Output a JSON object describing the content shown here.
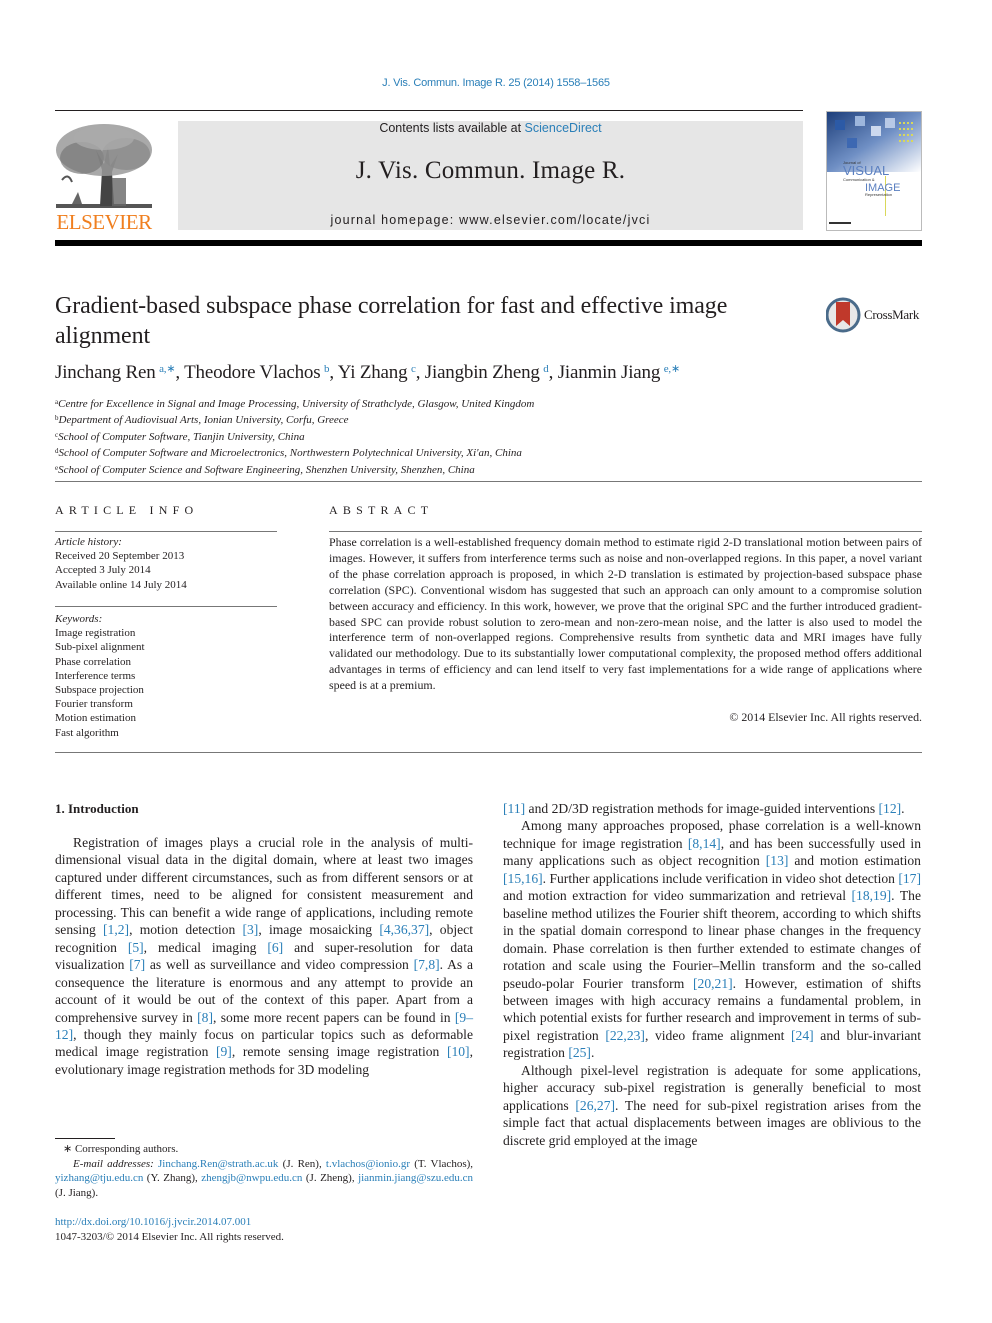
{
  "header": {
    "citation": "J. Vis. Commun. Image R. 25 (2014) 1558–1565",
    "contents_prefix": "Contents lists available at ",
    "contents_link": "ScienceDirect",
    "journal_title": "J. Vis. Commun. Image R.",
    "homepage": "journal homepage: www.elsevier.com/locate/jvci",
    "publisher_logo_text": "ELSEVIER",
    "cover": {
      "line1": "Journal of",
      "line2": "VISUAL",
      "line3": "Communication &",
      "line4": "IMAGE",
      "line5": "Representation"
    },
    "crossmark_label": "CrossMark"
  },
  "article": {
    "title": "Gradient-based subspace phase correlation for fast and effective image alignment",
    "authors": [
      {
        "name": "Jinchang Ren",
        "aff": "a,∗"
      },
      {
        "name": "Theodore Vlachos",
        "aff": "b"
      },
      {
        "name": "Yi Zhang",
        "aff": "c"
      },
      {
        "name": "Jiangbin Zheng",
        "aff": "d"
      },
      {
        "name": "Jianmin Jiang",
        "aff": "e,∗"
      }
    ],
    "affiliations": [
      {
        "key": "a",
        "text": "Centre for Excellence in Signal and Image Processing, University of Strathclyde, Glasgow, United Kingdom"
      },
      {
        "key": "b",
        "text": "Department of Audiovisual Arts, Ionian University, Corfu, Greece"
      },
      {
        "key": "c",
        "text": "School of Computer Software, Tianjin University, China"
      },
      {
        "key": "d",
        "text": "School of Computer Software and Microelectronics, Northwestern Polytechnical University, Xi'an, China"
      },
      {
        "key": "e",
        "text": "School of Computer Science and Software Engineering, Shenzhen University, Shenzhen, China"
      }
    ]
  },
  "article_info": {
    "heading": "ARTICLE INFO",
    "history_label": "Article history:",
    "received": "Received 20 September 2013",
    "accepted": "Accepted 3 July 2014",
    "online": "Available online 14 July 2014",
    "keywords_label": "Keywords:",
    "keywords": [
      "Image registration",
      "Sub-pixel alignment",
      "Phase correlation",
      "Interference terms",
      "Subspace projection",
      "Fourier transform",
      "Motion estimation",
      "Fast algorithm"
    ]
  },
  "abstract": {
    "heading": "ABSTRACT",
    "text": "Phase correlation is a well-established frequency domain method to estimate rigid 2-D translational motion between pairs of images. However, it suffers from interference terms such as noise and non-over­lapped regions. In this paper, a novel variant of the phase correlation approach is proposed, in which 2-D translation is estimated by projection-based subspace phase correlation (SPC). Conventional wisdom has suggested that such an approach can only amount to a compromise solution between accuracy and effi­ciency. In this work, however, we prove that the original SPC and the further introduced gradient-based SPC can provide robust solution to zero-mean and non-zero-mean noise, and the latter is also used to model the interference term of non-overlapped regions. Comprehensive results from synthetic data and MRI images have fully validated our methodology. Due to its substantially lower computational com­plexity, the proposed method offers additional advantages in terms of efficiency and can lend itself to very fast implementations for a wide range of applications where speed is at a premium.",
    "copyright": "© 2014 Elsevier Inc. All rights reserved."
  },
  "body": {
    "section_heading": "1. Introduction",
    "left_p1": [
      {
        "t": "Registration of images plays a crucial role in the analysis of multi-dimensional visual data in the digital domain, where at least two images captured under different circumstances, such as from different sensors or at different times, need to be aligned for con­sistent measurement and processing. This can benefit a wide range of applications, including remote sensing "
      },
      {
        "r": "[1,2]"
      },
      {
        "t": ", motion detection "
      },
      {
        "r": "[3]"
      },
      {
        "t": ", image mosaicking "
      },
      {
        "r": "[4,36,37]"
      },
      {
        "t": ", object recognition "
      },
      {
        "r": "[5]"
      },
      {
        "t": ", medical imaging "
      },
      {
        "r": "[6]"
      },
      {
        "t": " and super-resolution for data visualization "
      },
      {
        "r": "[7]"
      },
      {
        "t": " as well as surveillance and video compression "
      },
      {
        "r": "[7,8]"
      },
      {
        "t": ". As a consequence the literature is enormous and any attempt to provide an account of it would be out of the context of this paper. Apart from a comprehen­sive survey in "
      },
      {
        "r": "[8]"
      },
      {
        "t": ", some more recent papers can be found in "
      },
      {
        "r": "[9–12]"
      },
      {
        "t": ", though they mainly focus on particular topics such as deformable medical image registration "
      },
      {
        "r": "[9]"
      },
      {
        "t": ", remote sensing image registration "
      },
      {
        "r": "[10]"
      },
      {
        "t": ", evolutionary image registration methods for 3D modeling"
      }
    ],
    "right_p0": [
      {
        "r": "[11]"
      },
      {
        "t": " and 2D/3D registration methods for image-guided interven­tions "
      },
      {
        "r": "[12]"
      },
      {
        "t": "."
      }
    ],
    "right_p1": [
      {
        "t": "Among many approaches proposed, phase correlation is a well-known technique for image registration "
      },
      {
        "r": "[8,14]"
      },
      {
        "t": ", and has been suc­cessfully used in many applications such as object recognition "
      },
      {
        "r": "[13]"
      },
      {
        "t": " and motion estimation "
      },
      {
        "r": "[15,16]"
      },
      {
        "t": ". Further applications include verification in video shot detection "
      },
      {
        "r": "[17]"
      },
      {
        "t": " and motion extraction for video summarization and retrieval "
      },
      {
        "r": "[18,19]"
      },
      {
        "t": ". The baseline method utilizes the Fourier shift theorem, according to which shifts in the spatial domain correspond to linear phase changes in the frequency domain. Phase correlation is then further extended to estimate changes of rotation and scale using the Fou­rier–Mellin transform and the so-called pseudo-polar Fourier transform "
      },
      {
        "r": "[20,21]"
      },
      {
        "t": ". However, estimation of shifts between images with high accuracy remains a fundamental problem, in which potential exists for further research and improvement in terms of sub-pixel registration "
      },
      {
        "r": "[22,23]"
      },
      {
        "t": ", video frame alignment "
      },
      {
        "r": "[24]"
      },
      {
        "t": " and blur-invariant registration "
      },
      {
        "r": "[25]"
      },
      {
        "t": "."
      }
    ],
    "right_p2": [
      {
        "t": "Although pixel-level registration is adequate for some applica­tions, higher accuracy sub-pixel registration is generally beneficial to most applications "
      },
      {
        "r": "[26,27]"
      },
      {
        "t": ". The need for sub-pixel registration arises from the simple fact that actual displacements between images are oblivious to the discrete grid employed at the image"
      }
    ]
  },
  "footnotes": {
    "corresponding": "∗ Corresponding authors.",
    "email_label": "E-mail addresses:",
    "emails": [
      {
        "addr": "Jinchang.Ren@strath.ac.uk",
        "who": " (J. Ren), "
      },
      {
        "addr": "t.vlachos@ionio.gr",
        "who": " (T. Vlachos), "
      },
      {
        "addr": "yizhang@tju.edu.cn",
        "who": " (Y. Zhang), "
      },
      {
        "addr": "zhengjb@nwpu.edu.cn",
        "who": " (J. Zheng), "
      },
      {
        "addr": "jian­min.jiang@szu.edu.cn",
        "who": " (J. Jiang)."
      }
    ],
    "doi": "http://dx.doi.org/10.1016/j.jvcir.2014.07.001",
    "issn": "1047-3203/© 2014 Elsevier Inc. All rights reserved."
  },
  "colors": {
    "link": "#2a7fb8",
    "elsevier_orange": "#f07f1f",
    "masthead_bg": "#e6e6e6",
    "text": "#231f20"
  }
}
